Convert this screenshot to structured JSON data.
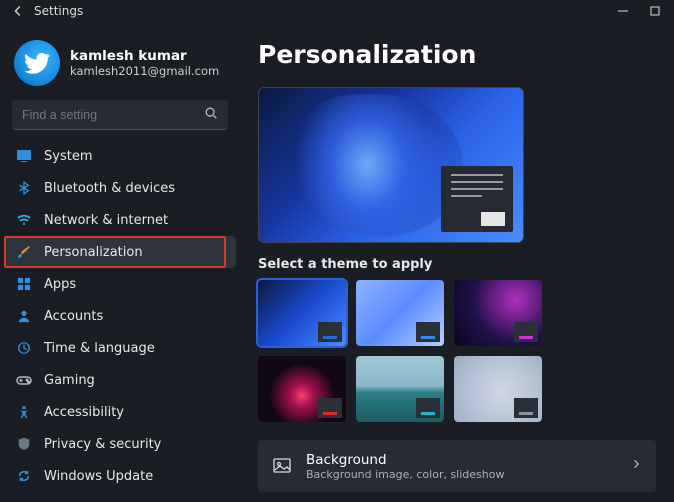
{
  "window": {
    "title": "Settings"
  },
  "profile": {
    "name": "kamlesh kumar",
    "email": "kamlesh2011@gmail.com"
  },
  "search": {
    "placeholder": "Find a setting"
  },
  "nav": [
    {
      "label": "System"
    },
    {
      "label": "Bluetooth & devices"
    },
    {
      "label": "Network & internet"
    },
    {
      "label": "Personalization"
    },
    {
      "label": "Apps"
    },
    {
      "label": "Accounts"
    },
    {
      "label": "Time & language"
    },
    {
      "label": "Gaming"
    },
    {
      "label": "Accessibility"
    },
    {
      "label": "Privacy & security"
    },
    {
      "label": "Windows Update"
    }
  ],
  "page": {
    "title": "Personalization",
    "theme_section_label": "Select a theme to apply",
    "background_row": {
      "title": "Background",
      "subtitle": "Background image, color, slideshow"
    }
  }
}
